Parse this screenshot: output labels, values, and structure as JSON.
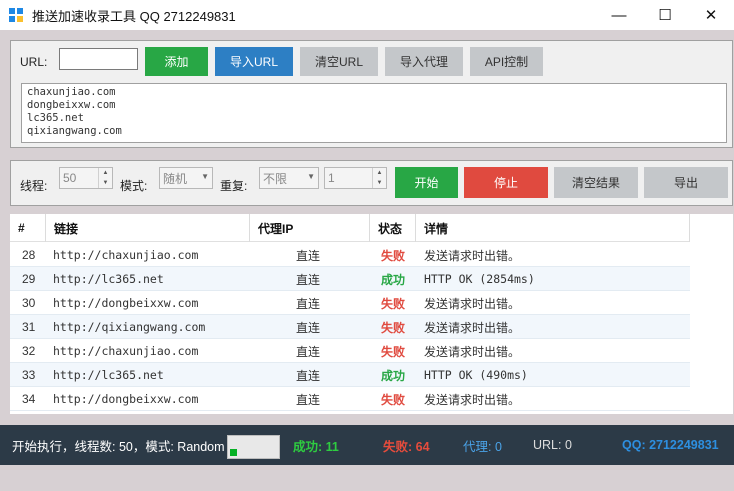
{
  "window": {
    "title": "推送加速收录工具 QQ 2712249831",
    "minimize": "—",
    "maximize": "☐",
    "close": "✕"
  },
  "url_panel": {
    "url_label": "URL:",
    "url_value": "",
    "buttons": {
      "add": "添加",
      "import_url": "导入URL",
      "clear_url": "清空URL",
      "import_proxy": "导入代理",
      "api_control": "API控制"
    },
    "url_list": [
      "chaxunjiao.com",
      "dongbeixxw.com",
      "lc365.net",
      "qixiangwang.com"
    ]
  },
  "control_panel": {
    "threads_label": "线程:",
    "threads_value": "50",
    "mode_label": "模式:",
    "mode_value": "随机",
    "repeat_label": "重复:",
    "repeat_value": "不限",
    "repeat_count": "1",
    "buttons": {
      "start": "开始",
      "stop": "停止",
      "clear_results": "清空结果",
      "export": "导出"
    }
  },
  "table": {
    "headers": [
      "#",
      "链接",
      "代理IP",
      "状态",
      "详情"
    ],
    "rows": [
      {
        "id": "28",
        "link": "http://chaxunjiao.com",
        "proxy": "直连",
        "status": "失败",
        "detail": "发送请求时出错。"
      },
      {
        "id": "29",
        "link": "http://lc365.net",
        "proxy": "直连",
        "status": "成功",
        "detail": "HTTP OK (2854ms)"
      },
      {
        "id": "30",
        "link": "http://dongbeixxw.com",
        "proxy": "直连",
        "status": "失败",
        "detail": "发送请求时出错。"
      },
      {
        "id": "31",
        "link": "http://qixiangwang.com",
        "proxy": "直连",
        "status": "失败",
        "detail": "发送请求时出错。"
      },
      {
        "id": "32",
        "link": "http://chaxunjiao.com",
        "proxy": "直连",
        "status": "失败",
        "detail": "发送请求时出错。"
      },
      {
        "id": "33",
        "link": "http://lc365.net",
        "proxy": "直连",
        "status": "成功",
        "detail": "HTTP OK (490ms)"
      },
      {
        "id": "34",
        "link": "http://dongbeixxw.com",
        "proxy": "直连",
        "status": "失败",
        "detail": "发送请求时出错。"
      }
    ]
  },
  "statusbar": {
    "message": "开始执行，线程数: 50，模式: Random",
    "progress_fraction": 0.07,
    "success": "成功: 11",
    "fail": "失败: 64",
    "proxy": "代理: 0",
    "url_count": "URL: 0",
    "qq": "QQ: 2712249831"
  },
  "colors": {
    "success": "#28a745",
    "fail": "#e04a3f",
    "accent_blue": "#2d7fc4",
    "statusbar_bg": "#2c3a47"
  }
}
